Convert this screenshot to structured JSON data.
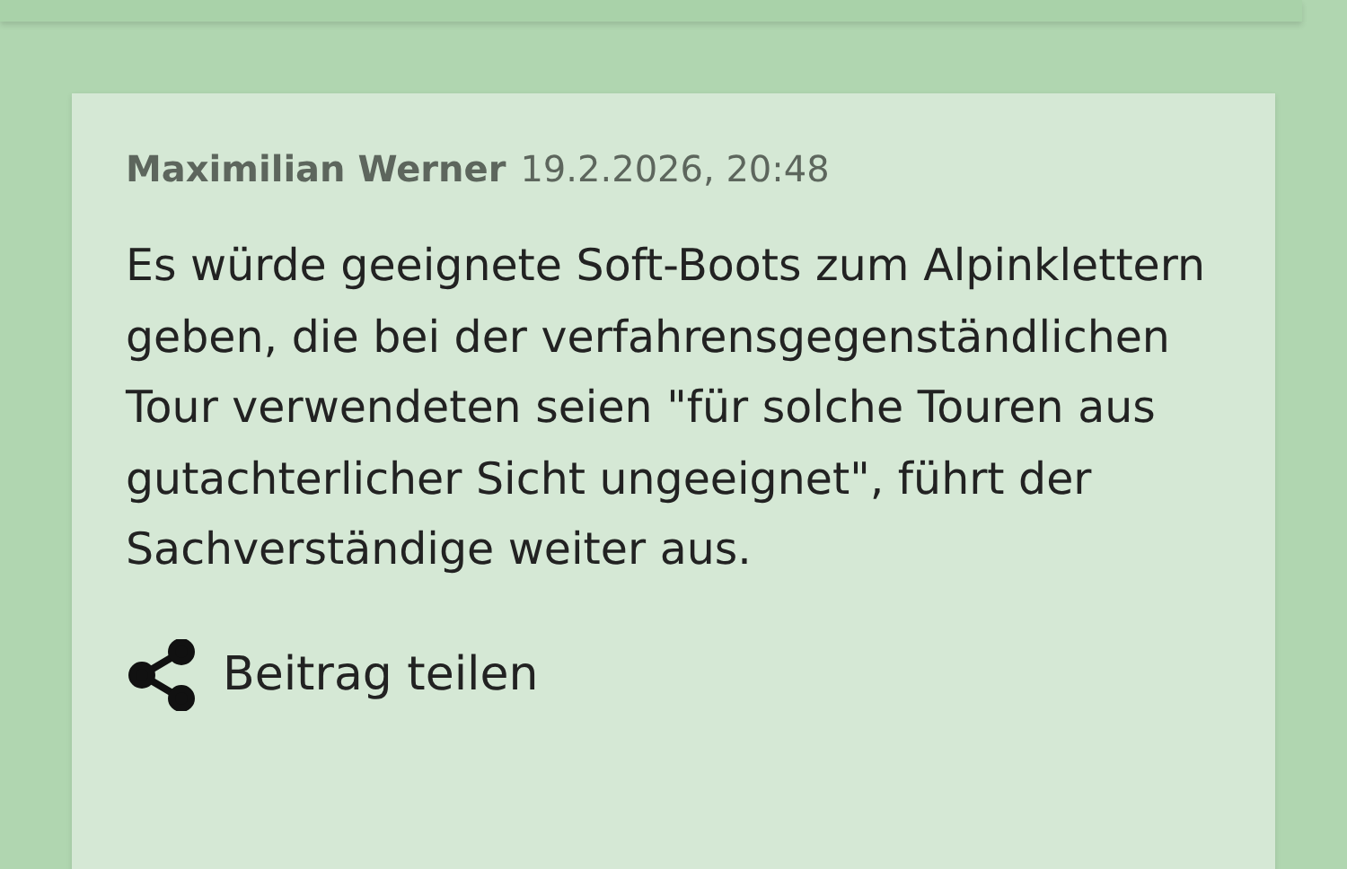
{
  "comment": {
    "author": "Maximilian Werner",
    "timestamp": "19.2.2026, 20:48",
    "text": "Es würde geeignete Soft-Boots zum Alpinklettern geben, die bei der verfahrensgegenständlichen Tour verwendeten seien \"für solche Touren aus gutachterlicher Sicht ungeeignet\", führt der Sachverständige weiter aus.",
    "share_label": "Beitrag teilen"
  }
}
